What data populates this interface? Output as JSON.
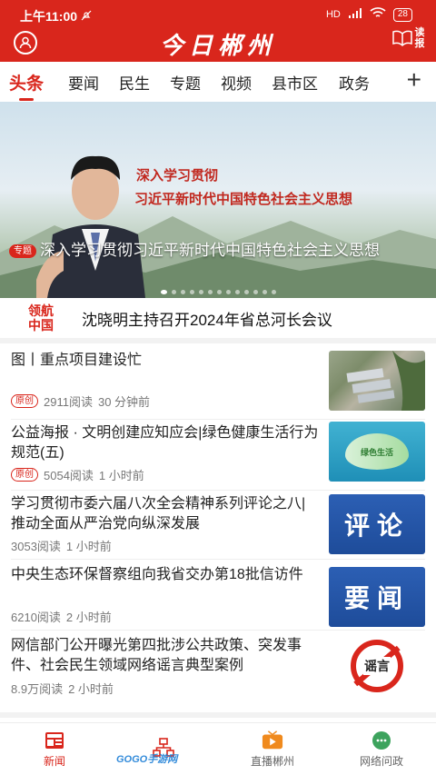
{
  "status": {
    "time": "上午11:00",
    "battery": "28",
    "network": "HD"
  },
  "header": {
    "logo": "今日郴州",
    "read_label": "读报"
  },
  "tabs": [
    "头条",
    "要闻",
    "民生",
    "专题",
    "视频",
    "县市区",
    "政务"
  ],
  "tab_add": "+",
  "banner": {
    "slogan_line1": "深入学习贯彻",
    "slogan_line2": "习近平新时代中国特色社会主义思想",
    "tag": "专题",
    "caption": "深入学习贯彻习近平新时代中国特色社会主义思想",
    "dot_count": 13,
    "active_dot": 0
  },
  "lead": {
    "badge_line1": "领航",
    "badge_line2": "中国",
    "title": "沈晓明主持召开2024年省总河长会议"
  },
  "news": [
    {
      "title": "图丨重点项目建设忙",
      "original": "原创",
      "reads": "2911阅读",
      "time": "30 分钟前",
      "thumb": "aerial"
    },
    {
      "title": "公益海报 · 文明创建应知应会|绿色健康生活行为规范(五)",
      "original": "原创",
      "reads": "5054阅读",
      "time": "1 小时前",
      "thumb": "poster",
      "thumb_text": "绿色生活"
    },
    {
      "title": "学习贯彻市委六届八次全会精神系列评论之八|推动全面从严治党向纵深发展",
      "original": "",
      "reads": "3053阅读",
      "time": "1 小时前",
      "thumb": "word",
      "thumb_text": "评论"
    },
    {
      "title": "中央生态环保督察组向我省交办第18批信访件",
      "original": "",
      "reads": "6210阅读",
      "time": "2 小时前",
      "thumb": "word",
      "thumb_text": "要闻"
    },
    {
      "title": "网信部门公开曝光第四批涉公共政策、突发事件、社会民生领域网络谣言典型案例",
      "original": "",
      "reads": "8.9万阅读",
      "time": "2 小时前",
      "thumb": "rumor",
      "thumb_text": "谣言"
    }
  ],
  "bottom_nav": [
    {
      "label": "新闻",
      "icon": "newspaper-icon",
      "active": true
    },
    {
      "label": "",
      "icon": "sitemap-icon",
      "active": false
    },
    {
      "label": "直播郴州",
      "icon": "tv-icon",
      "active": false
    },
    {
      "label": "网络问政",
      "icon": "chat-icon",
      "active": false
    }
  ],
  "watermark": "GOGO手游网",
  "colors": {
    "brand": "#d9261c",
    "badge_blue": "#2c5fb4"
  }
}
